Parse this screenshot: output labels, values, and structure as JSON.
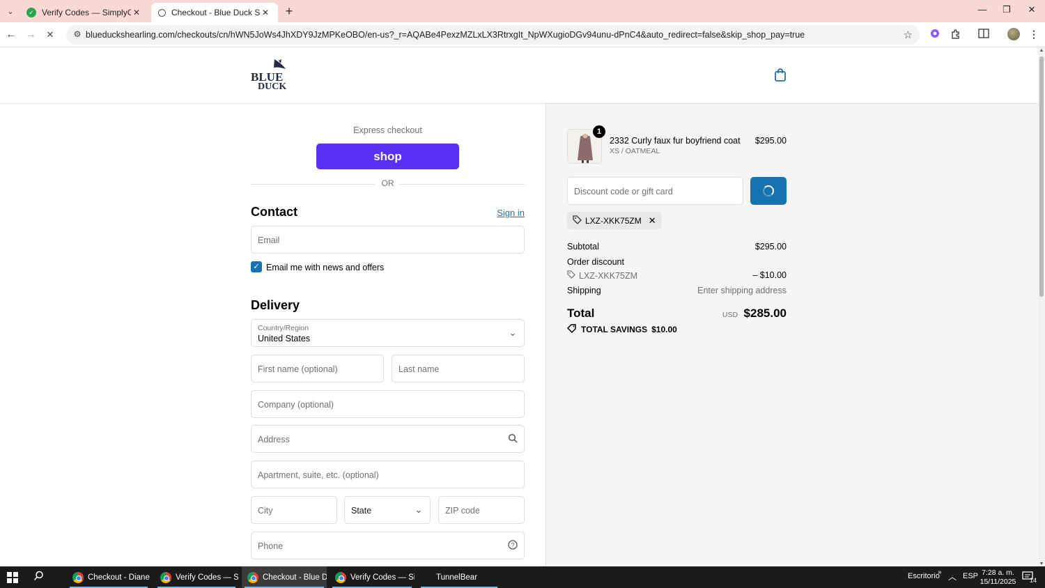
{
  "browser": {
    "tabs": [
      {
        "label": "Verify Codes — SimplyCodes",
        "active": false
      },
      {
        "label": "Checkout - Blue Duck Shearling",
        "active": true
      }
    ],
    "url": "blueduckshearling.com/checkouts/cn/hWN5JoWs4JhXDY9JzMPKeOBO/en-us?_r=AQABe4PexzMZLxLX3RtrxgIt_NpWXugioDGv94unu-dPnC4&auto_redirect=false&skip_shop_pay=true",
    "icons": {
      "back": "←",
      "forward": "→",
      "stop": "✕",
      "star": "☆"
    }
  },
  "store": {
    "logo_text": "BLUE DUCK"
  },
  "checkout": {
    "express_label": "Express checkout",
    "shop_label": "shop",
    "or_label": "OR",
    "contact_title": "Contact",
    "sign_in": "Sign in",
    "email_placeholder": "Email",
    "news_label": "Email me with news and offers",
    "news_checked": true,
    "delivery_title": "Delivery",
    "country_label": "Country/Region",
    "country_value": "United States",
    "first_name_placeholder": "First name (optional)",
    "last_name_placeholder": "Last name",
    "company_placeholder": "Company (optional)",
    "address_placeholder": "Address",
    "apartment_placeholder": "Apartment, suite, etc. (optional)",
    "city_placeholder": "City",
    "state_placeholder": "State",
    "zip_placeholder": "ZIP code",
    "phone_placeholder": "Phone"
  },
  "summary": {
    "quantity": "1",
    "product_name": "2332 Curly faux fur boyfriend coat",
    "product_variant": "XS / OATMEAL",
    "product_price": "$295.00",
    "discount_placeholder": "Discount code or gift card",
    "applied_code": "LXZ-XKK75ZM",
    "subtotal_label": "Subtotal",
    "subtotal_value": "$295.00",
    "order_discount_label": "Order discount",
    "discount_code_line": "LXZ-XKK75ZM",
    "discount_value": "– $10.00",
    "shipping_label": "Shipping",
    "shipping_value": "Enter shipping address",
    "total_label": "Total",
    "total_currency": "USD",
    "total_value": "$285.00",
    "savings_label": "TOTAL SAVINGS",
    "savings_value": "$10.00"
  },
  "taskbar": {
    "apps": [
      {
        "label": "Checkout - Diane K..."
      },
      {
        "label": "Verify Codes — Sim..."
      },
      {
        "label": "Checkout - Blue Du..."
      },
      {
        "label": "Verify Codes — Sim..."
      },
      {
        "label": "TunnelBear"
      }
    ],
    "desktop_label": "Escritorio",
    "lang": "ESP",
    "time": "7:28 a. m.",
    "date": "15/11/2025",
    "notif_count": "14"
  },
  "colors": {
    "accent": "#1773b0",
    "shop": "#5a31f4",
    "tabstrip": "#f9d9d4"
  }
}
